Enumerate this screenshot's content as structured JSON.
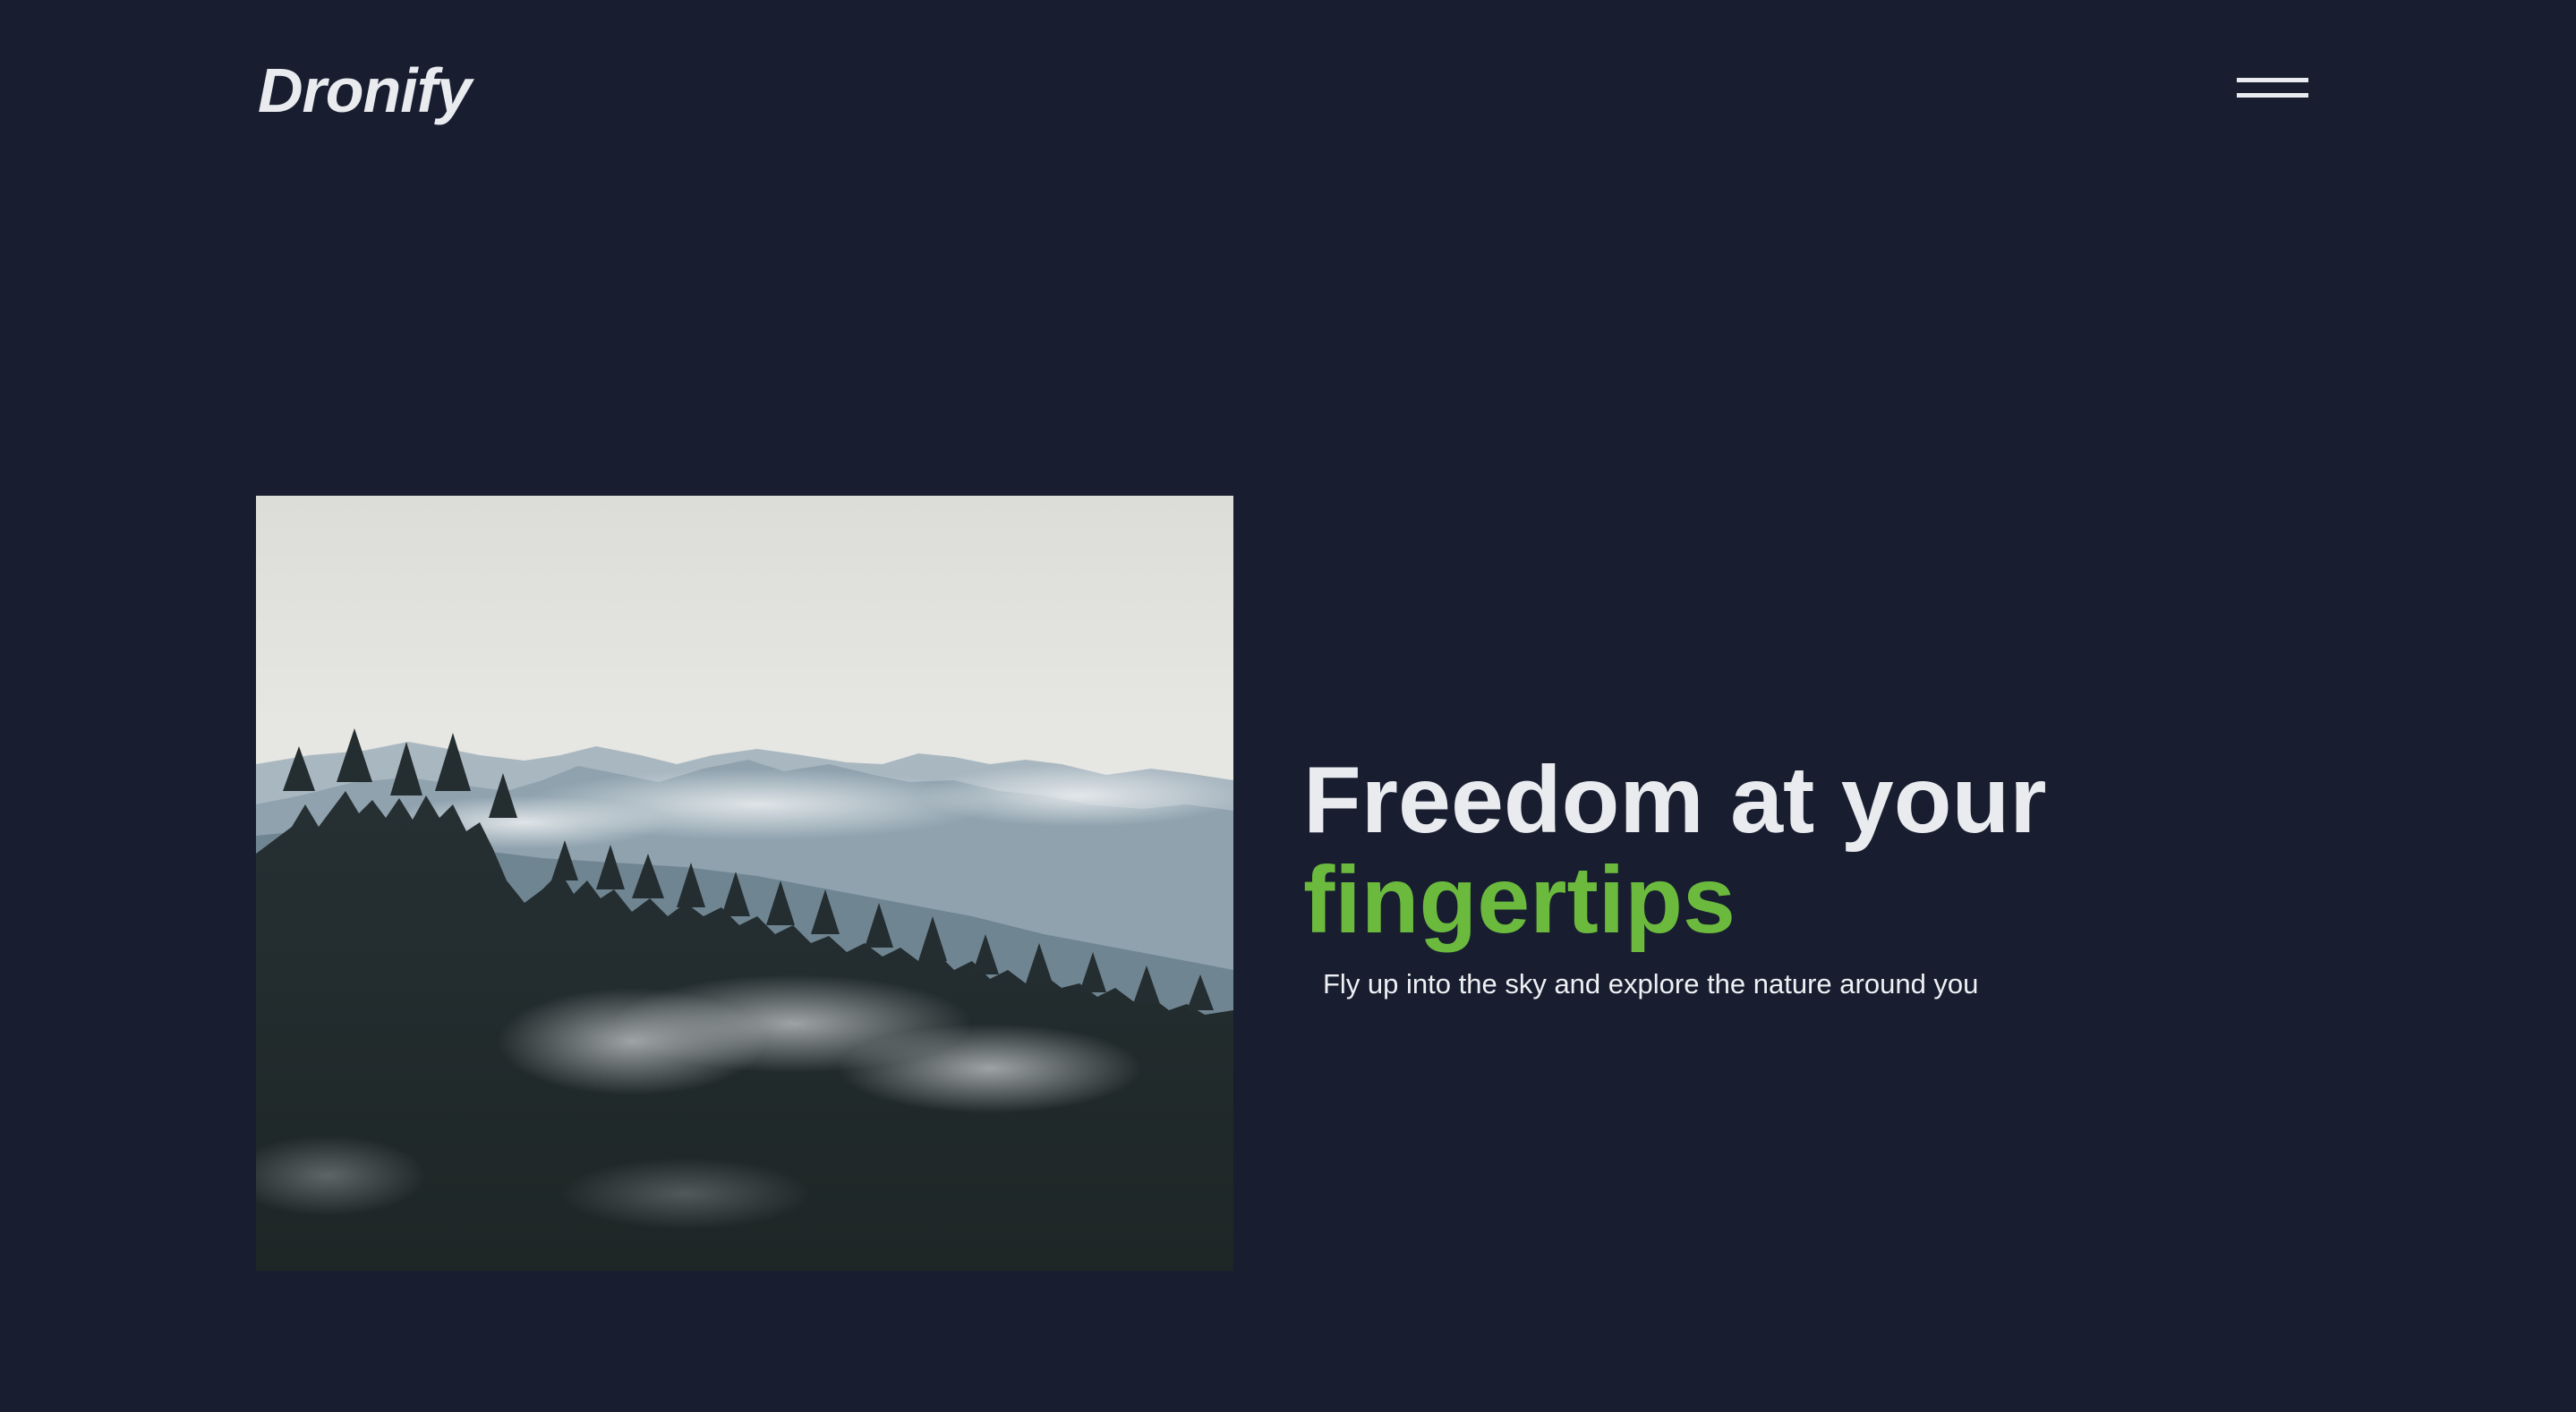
{
  "header": {
    "logo_text": "Dronify",
    "menu_icon": "hamburger-menu-icon"
  },
  "hero": {
    "image_subject": "misty-mountain-forest",
    "headline_line1": "Freedom at your",
    "headline_accent": "fingertips",
    "subtitle": "Fly up into the sky and explore the nature around you"
  },
  "colors": {
    "background": "#181e30",
    "text": "#e9ebef",
    "accent": "#6cba3d"
  }
}
